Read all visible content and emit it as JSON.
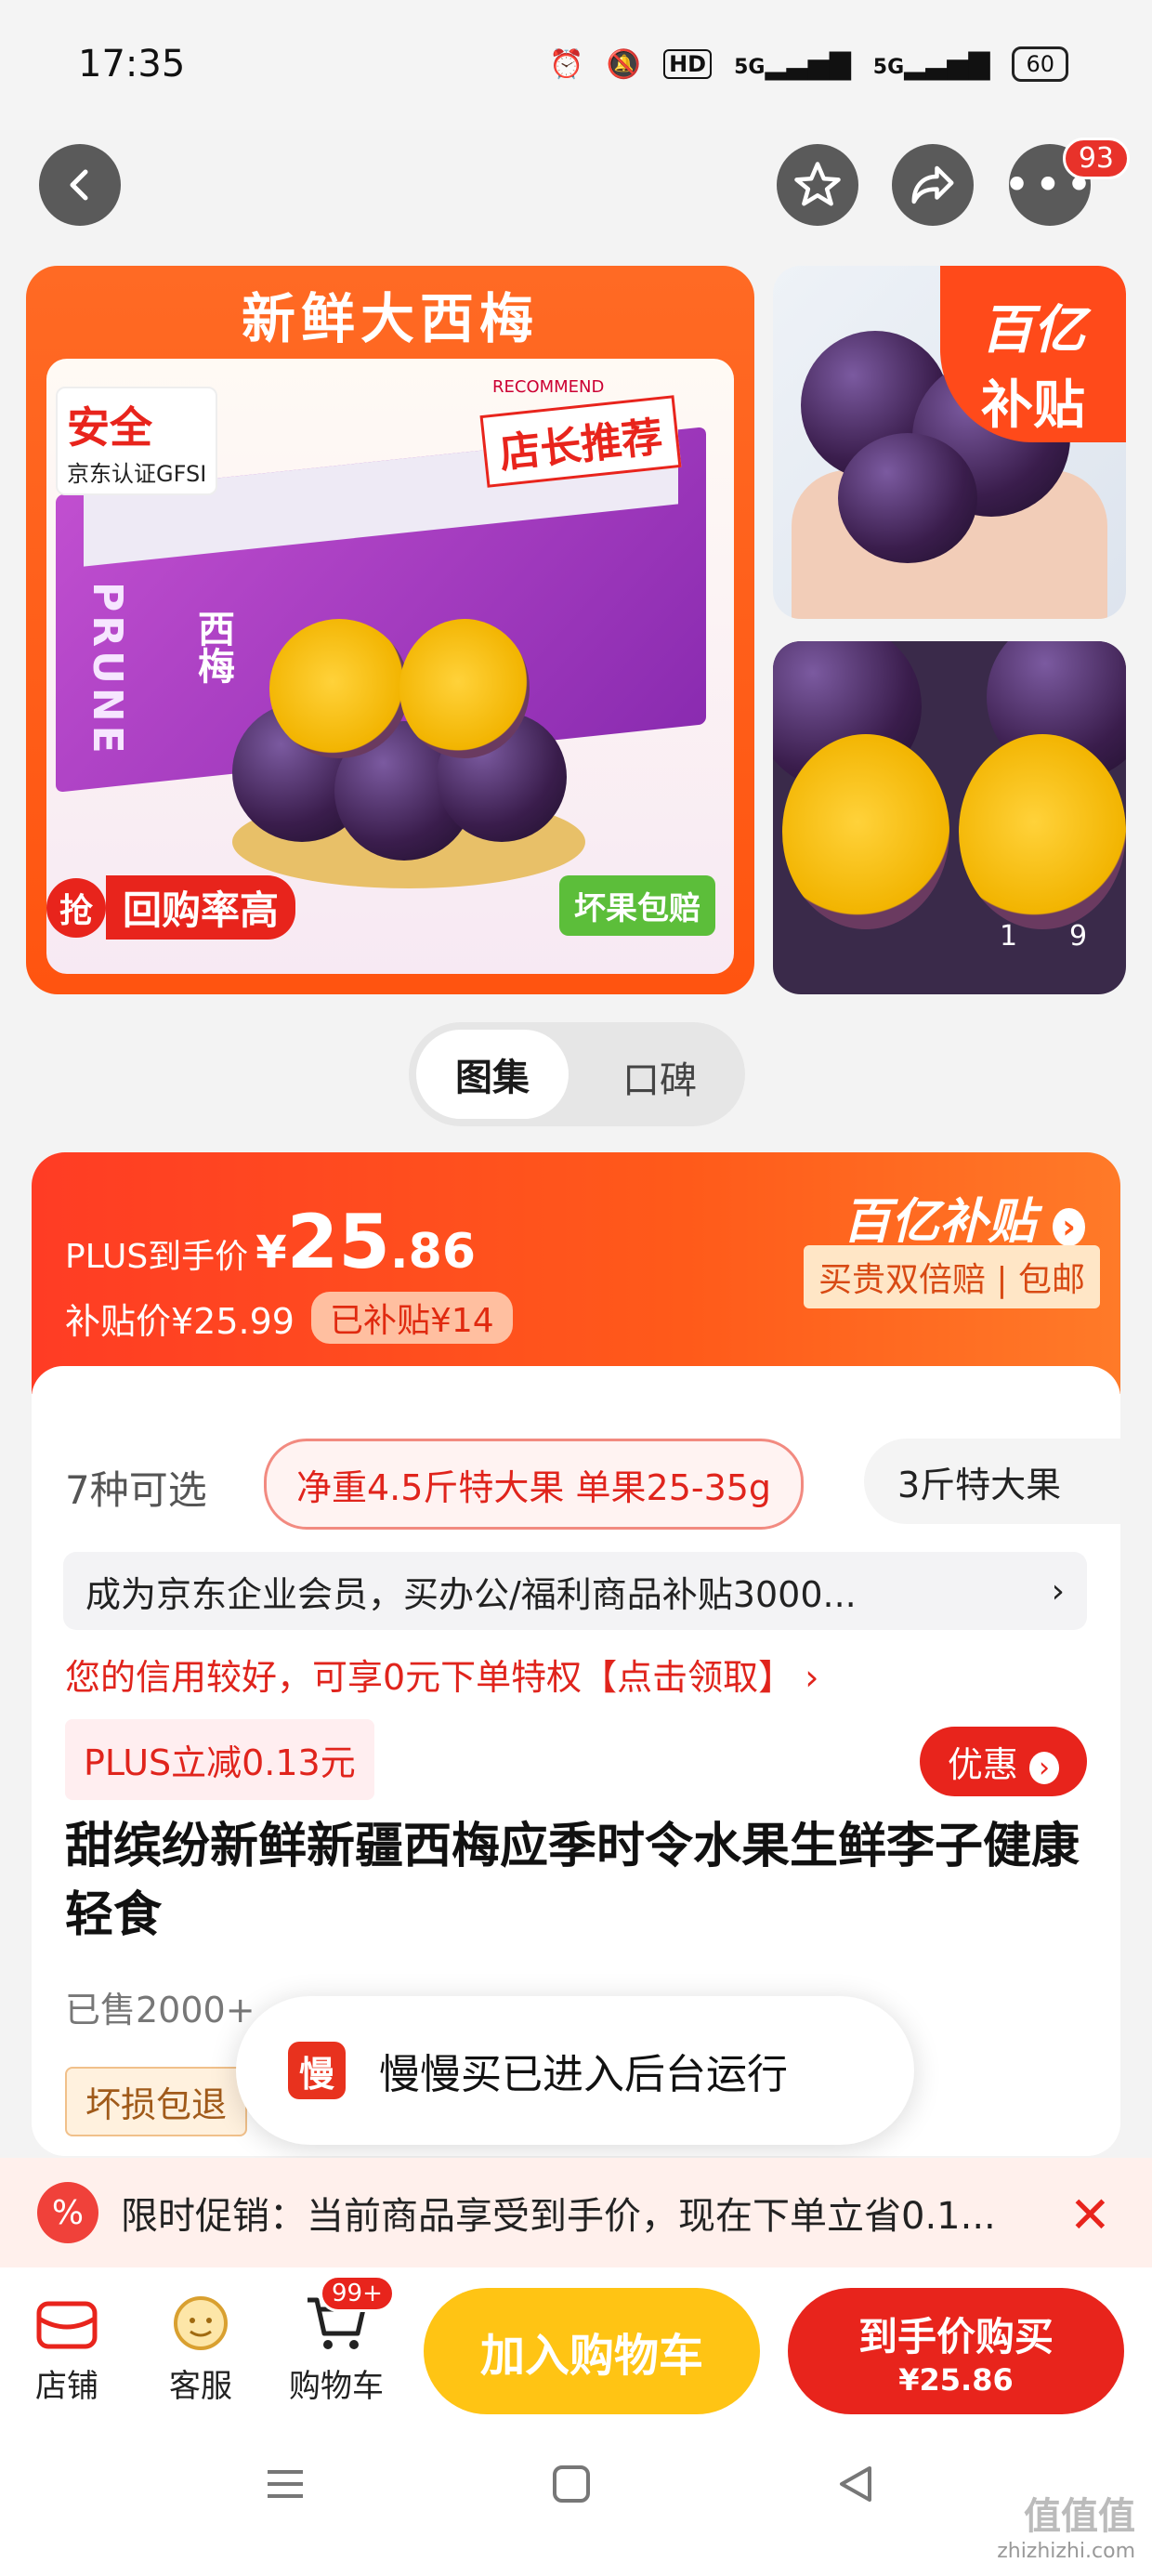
{
  "status_bar": {
    "time": "17:35",
    "net1": "5G",
    "net2": "5G",
    "hd": "HD",
    "battery": "60"
  },
  "top_nav": {
    "cart_badge": "93"
  },
  "gallery": {
    "main_banner": "新鲜大西梅",
    "safe_label": "安全",
    "safe_sub": "京东认证GFSI",
    "shop_recommend": "店长推荐",
    "recommend_en": "RECOMMEND",
    "box_text": "PRUNE",
    "box_cn": "西梅",
    "repurchase": "回购率高",
    "grab": "抢",
    "bad_fruit": "坏果包赔",
    "subsidy_corner_1": "百亿",
    "subsidy_corner_2": "补贴",
    "counter_a": "1",
    "counter_b": "9"
  },
  "tabs": [
    {
      "label": "图集"
    },
    {
      "label": "口碑"
    }
  ],
  "price": {
    "plus_label": "PLUS到手价",
    "currency": "¥",
    "integer": "25",
    "decimal": ".86",
    "sub_price": "补贴价¥25.99",
    "subsidized": "已补贴¥14",
    "subsidy_logo": "百亿补贴",
    "subsidy_tag": "买贵双倍赔 | 包邮"
  },
  "variants": {
    "count": "7种可选",
    "selected": "净重4.5斤特大果 单果25-35g",
    "next": "3斤特大果"
  },
  "member_bar": "成为京东企业会员，买办公/福利商品补贴3000...",
  "credit_text": "您的信用较好，可享0元下单特权【点击领取】 ›",
  "plus_discount": "PLUS立减0.13元",
  "coupon_btn": "优惠",
  "product_title": "甜缤纷新鲜新疆西梅应季时令水果生鲜李子健康轻食",
  "sold": "已售2000+",
  "return_tag": "坏损包退",
  "toast": {
    "icon": "慢",
    "text": "慢慢买已进入后台运行"
  },
  "promo": {
    "icon": "%",
    "text": "限时促销：当前商品享受到手价，现在下单立省0.1..."
  },
  "actions": {
    "shop": "店铺",
    "service": "客服",
    "cart": "购物车",
    "cart_count": "99+",
    "add_cart": "加入购物车",
    "buy_line1": "到手价购买",
    "buy_line2": "¥25.86"
  },
  "watermark": {
    "line1": "值值值",
    "line2": "zhizhizhi.com"
  },
  "colors": {
    "accent": "#e8241c",
    "orange": "#ff5a1a",
    "yellow": "#ffc414"
  }
}
